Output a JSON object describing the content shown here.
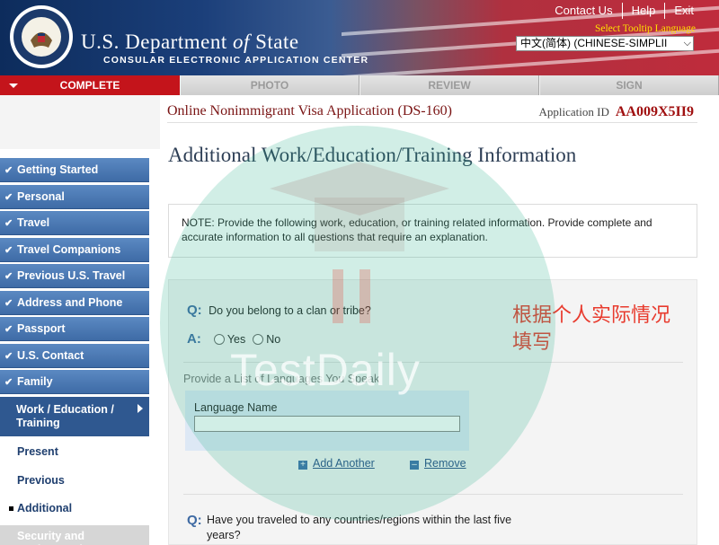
{
  "header": {
    "dept_prefix": "U.S. Department",
    "dept_of": "of",
    "dept_suffix": "State",
    "subtitle": "CONSULAR ELECTRONIC APPLICATION CENTER",
    "top_links": [
      "Contact Us",
      "Help",
      "Exit"
    ],
    "tooltip_label": "Select Tooltip Language",
    "tooltip_value": "中文(简体)  (CHINESE-SIMPLII"
  },
  "progress_tabs": [
    {
      "label": "COMPLETE",
      "active": true
    },
    {
      "label": "PHOTO",
      "active": false
    },
    {
      "label": "REVIEW",
      "active": false
    },
    {
      "label": "SIGN",
      "active": false
    }
  ],
  "app": {
    "title": "Online Nonimmigrant Visa Application (DS-160)",
    "id_label": "Application ID",
    "id_value": "AA009X5II9"
  },
  "sidebar": {
    "completed": [
      "Getting Started",
      "Personal",
      "Travel",
      "Travel Companions",
      "Previous U.S. Travel",
      "Address and Phone",
      "Passport",
      "U.S. Contact",
      "Family"
    ],
    "current": "Work / Education / Training",
    "sub_items": [
      "Present",
      "Previous",
      "Additional"
    ],
    "next_item": "Security and Background"
  },
  "main": {
    "heading": "Additional Work/Education/Training Information",
    "note": "NOTE: Provide the following work, education, or training related information. Provide complete and accurate information to all questions that require an explanation.",
    "q_mark": "Q:",
    "a_mark": "A:",
    "q1": "Do you belong to a clan or tribe?",
    "yes": "Yes",
    "no": "No",
    "languages_label": "Provide a List of Languages You Speak",
    "language_name_label": "Language Name",
    "language_name_value": "",
    "add_another": "Add Another",
    "remove": "Remove",
    "q2": "Have you traveled to any countries/regions within the last five years?"
  },
  "overlay": {
    "chinese_note": "根据个人实际情况填写",
    "watermark": "TestDaily"
  },
  "colors": {
    "active_tab": "#c4141b",
    "nav_blue": "#4a78b5",
    "q_blue": "#3e6aa3",
    "annotation_red": "#e83b2e",
    "watermark_green": "#2cb28c"
  }
}
